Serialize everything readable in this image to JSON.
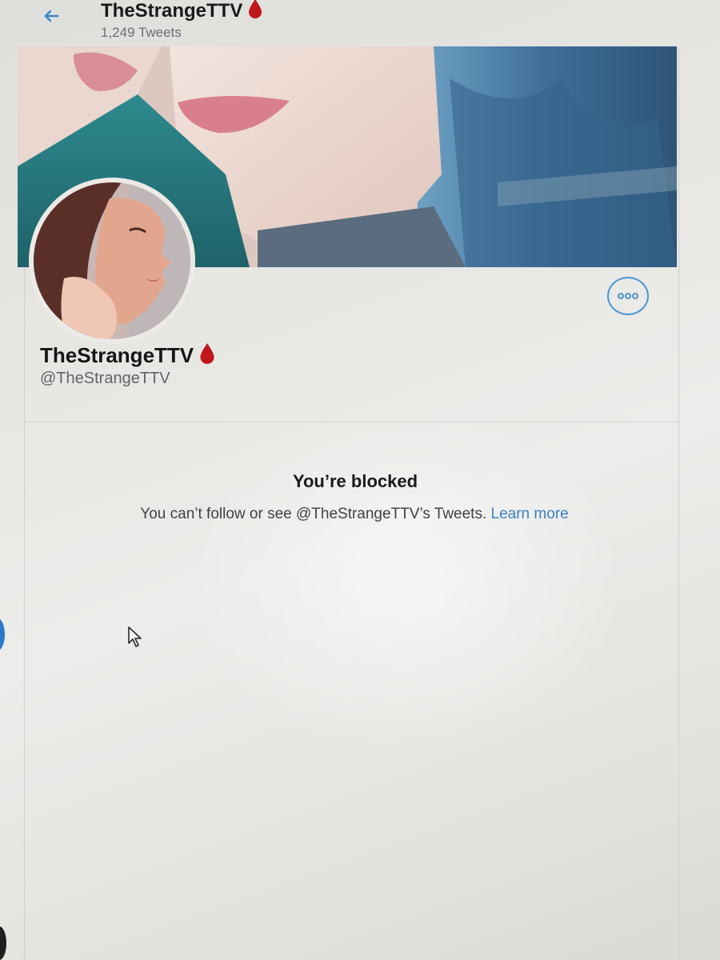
{
  "header": {
    "title": "TheStrangeTTV",
    "tweet_count": "1,249 Tweets"
  },
  "profile": {
    "name": "TheStrangeTTV",
    "handle": "@TheStrangeTTV"
  },
  "blocked": {
    "title": "You’re blocked",
    "message": "You can’t follow or see @TheStrangeTTV’s Tweets.",
    "learn_more": "Learn more"
  },
  "colors": {
    "accent": "#3a80c3",
    "drop": "#c0171c"
  },
  "icons": {
    "back": "back-arrow-icon",
    "name_emoji": "blood-drop-icon",
    "more": "more-options-icon"
  }
}
